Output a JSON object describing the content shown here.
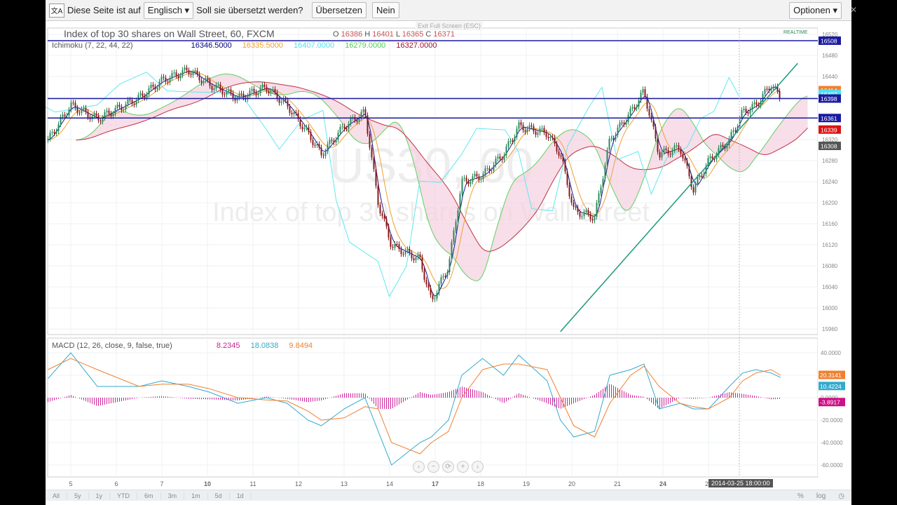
{
  "translate_bar": {
    "icon": "translate-icon",
    "text1": "Diese Seite ist auf",
    "language": "Englisch ▾",
    "text2": "Soll sie übersetzt werden?",
    "translate": "Übersetzen",
    "no": "Nein",
    "options": "Optionen ▾",
    "close": "✕"
  },
  "exit_fullscreen": "Exit Full Screen (ESC)",
  "realtime": "REALTIME",
  "legend": {
    "title": "Index of top 30 shares on Wall Street, 60, FXCM",
    "o_label": "O",
    "o": "16386",
    "h_label": "H",
    "h": "16401",
    "l_label": "L",
    "l": "16365",
    "c_label": "C",
    "c": "16371",
    "ichimoku": "Ichimoku (7, 22, 44, 22)",
    "ichi_values": [
      "16346.5000",
      "16335.5000",
      "16407.0000",
      "16279.0000",
      "16327.0000"
    ],
    "ichi_colors": [
      "#000080",
      "#f0a030",
      "#50e0f0",
      "#50d050",
      "#a01030"
    ],
    "macd": "MACD (12, 26, close, 9, false, true)",
    "macd_values": [
      "8.2345",
      "18.0838",
      "9.8494"
    ],
    "macd_colors": [
      "#cc2299",
      "#33aacc",
      "#f08030"
    ]
  },
  "watermark": {
    "symbol": "US30, 60",
    "desc": "Index of top 30 shares on Wall Street"
  },
  "tooltip": "2014-03-25 18:00:00",
  "ranges": [
    "All",
    "5y",
    "1y",
    "YTD",
    "6m",
    "3m",
    "1m",
    "5d",
    "1d"
  ],
  "scale_buttons": [
    "%",
    "log"
  ],
  "chart_data": [
    {
      "type": "candlestick",
      "title": "Index of top 30 shares on Wall Street, 60, FXCM",
      "symbol": "US30",
      "interval": "60",
      "x_ticks": [
        "5",
        "6",
        "7",
        "10",
        "11",
        "12",
        "13",
        "14",
        "17",
        "18",
        "19",
        "20",
        "21",
        "24",
        "25"
      ],
      "y_ticks": [
        16520,
        16480,
        16440,
        16400,
        16360,
        16320,
        16280,
        16240,
        16200,
        16160,
        16120,
        16080,
        16040,
        16000,
        15960
      ],
      "ylim": [
        15950,
        16530
      ],
      "close": [
        [
          "2014-03-04 12:00",
          16319
        ],
        [
          "2014-03-05 00:00",
          16385
        ],
        [
          "2014-03-05 14:00",
          16359
        ],
        [
          "2014-03-06 12:00",
          16399
        ],
        [
          "2014-03-07 00:00",
          16432
        ],
        [
          "2014-03-07 14:00",
          16452
        ],
        [
          "2014-03-10 01:00",
          16425
        ],
        [
          "2014-03-10 16:00",
          16399
        ],
        [
          "2014-03-11 07:00",
          16419
        ],
        [
          "2014-03-11 18:00",
          16385
        ],
        [
          "2014-03-12 05:00",
          16332
        ],
        [
          "2014-03-12 12:00",
          16292
        ],
        [
          "2014-03-13 00:00",
          16345
        ],
        [
          "2014-03-13 11:00",
          16372
        ],
        [
          "2014-03-13 18:00",
          16199
        ],
        [
          "2014-03-14 01:00",
          16119
        ],
        [
          "2014-03-14 16:00",
          16092
        ],
        [
          "2014-03-14 22:00",
          16012
        ],
        [
          "2014-03-17 07:00",
          16079
        ],
        [
          "2014-03-17 14:00",
          16239
        ],
        [
          "2014-03-18 01:00",
          16252
        ],
        [
          "2014-03-18 12:00",
          16292
        ],
        [
          "2014-03-18 20:00",
          16345
        ],
        [
          "2014-03-19 11:00",
          16332
        ],
        [
          "2014-03-19 18:00",
          16292
        ],
        [
          "2014-03-20 01:00",
          16185
        ],
        [
          "2014-03-20 12:00",
          16172
        ],
        [
          "2014-03-20 20:00",
          16319
        ],
        [
          "2014-03-21 07:00",
          16372
        ],
        [
          "2014-03-21 14:00",
          16412
        ],
        [
          "2014-03-21 22:00",
          16292
        ],
        [
          "2014-03-24 09:00",
          16305
        ],
        [
          "2014-03-24 16:00",
          16225
        ],
        [
          "2014-03-25 00:00",
          16279
        ],
        [
          "2014-03-25 11:00",
          16319
        ],
        [
          "2014-03-25 18:00",
          16372
        ],
        [
          "2014-03-26 01:00",
          16385
        ],
        [
          "2014-03-26 09:00",
          16425
        ],
        [
          "2014-03-26 14:00",
          16399
        ]
      ],
      "horizontal_lines": [
        16508,
        16398,
        16361
      ],
      "trend_line": [
        [
          "2014-03-19 18:00",
          15955
        ],
        [
          "2014-03-26 23:00",
          16465
        ]
      ],
      "price_badges": [
        {
          "v": "16508",
          "color": "#1a1aa0"
        },
        {
          "v": "16414",
          "color": "#f08030"
        },
        {
          "v": "16407",
          "color": "#50e0f0"
        },
        {
          "v": "16398",
          "color": "#1a1aa0"
        },
        {
          "v": "16361",
          "color": "#1a1aa0"
        },
        {
          "v": "16339",
          "color": "#dd1111"
        },
        {
          "v": "16308",
          "color": "#555555"
        }
      ],
      "colors": {
        "up": "#2a8a5a",
        "down": "#8b1a1a",
        "cloud": "#f4d0e0",
        "hline": "#1a1aa0",
        "trend": "#1a9a7a"
      }
    },
    {
      "type": "macd",
      "y_ticks": [
        40,
        20,
        0,
        -20,
        -40,
        -60
      ],
      "y_tick_labels": [
        "40.0000",
        "20.0000",
        "0.0000",
        "-20.0000",
        "-40.0000",
        "-60.0000"
      ],
      "ylim": [
        -68,
        48
      ],
      "macd": [
        17,
        40,
        10,
        10,
        15,
        10,
        5,
        -5,
        0,
        -5,
        -20,
        -25,
        -10,
        0,
        -30,
        -60,
        -40,
        -35,
        -20,
        20,
        35,
        20,
        38,
        15,
        -20,
        -35,
        -30,
        20,
        25,
        30,
        -10,
        -5,
        -10,
        -10,
        10,
        22,
        25,
        22,
        18
      ],
      "signal": [
        25,
        35,
        25,
        10,
        12,
        12,
        8,
        0,
        -2,
        -3,
        -12,
        -20,
        -18,
        -8,
        -10,
        -40,
        -50,
        -40,
        -30,
        0,
        25,
        30,
        30,
        25,
        0,
        -25,
        -35,
        -5,
        20,
        28,
        10,
        -5,
        -8,
        -10,
        0,
        15,
        22,
        25,
        20
      ],
      "badges": [
        {
          "v": "20.3141",
          "color": "#f08030"
        },
        {
          "v": "10.4224",
          "color": "#33aacc"
        },
        {
          "v": "-3.8917",
          "color": "#cc1188"
        }
      ]
    }
  ]
}
